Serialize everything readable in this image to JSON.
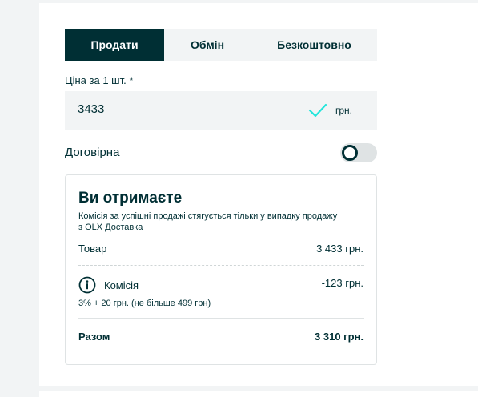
{
  "tabs": [
    {
      "label": "Продати",
      "active": true
    },
    {
      "label": "Обмін",
      "active": false
    },
    {
      "label": "Безкоштовно",
      "active": false
    }
  ],
  "price": {
    "label": "Ціна за 1 шт. *",
    "value": "3433",
    "currency": "грн.",
    "valid_icon": "check-icon"
  },
  "negotiable": {
    "label": "Договірна",
    "enabled": false
  },
  "summary": {
    "title": "Ви отримаєте",
    "note": "Комісія за успішні продажі стягується тільки у випадку продажу з OLX Доставка",
    "item_label": "Товар",
    "item_value": "3 433 грн.",
    "fee_label": "Комісія",
    "fee_value": "-123 грн.",
    "fee_detail": "3% + 20 грн. (не більше 499 грн)",
    "total_label": "Разом",
    "total_value": "3 310 грн."
  },
  "colors": {
    "primary": "#002f34",
    "background": "#f2f4f5",
    "check": "#23e5db"
  }
}
